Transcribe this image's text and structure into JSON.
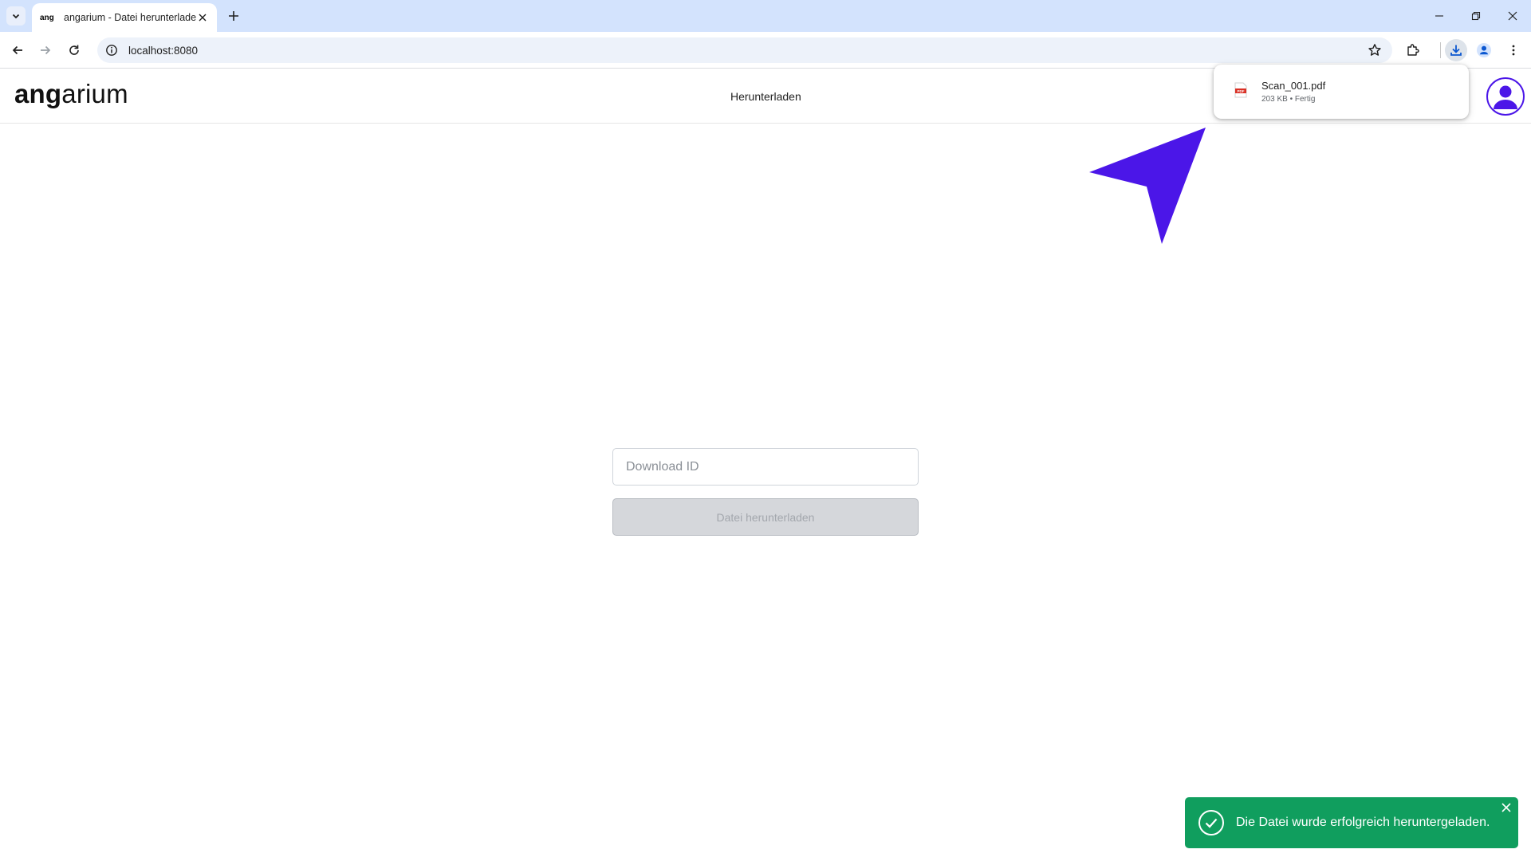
{
  "browser": {
    "tab": {
      "favicon_text": "ang",
      "title": "angarium - Datei herunterladen"
    },
    "address": {
      "url": "localhost:8080"
    }
  },
  "app": {
    "logo": {
      "bold": "ang",
      "regular": "arium"
    },
    "nav": {
      "download_label": "Herunterladen"
    },
    "form": {
      "input_placeholder": "Download ID",
      "input_value": "",
      "button_label": "Datei herunterladen"
    },
    "toast": {
      "message": "Die Datei wurde erfolgreich heruntergeladen."
    }
  },
  "download_bubble": {
    "file_name": "Scan_001.pdf",
    "file_meta": "203 KB • Fertig",
    "file_icon": "pdf-file-icon"
  },
  "colors": {
    "brand_accent": "#4b16e8",
    "toast_success": "#109e5e",
    "tabbar": "#d3e3fd"
  }
}
